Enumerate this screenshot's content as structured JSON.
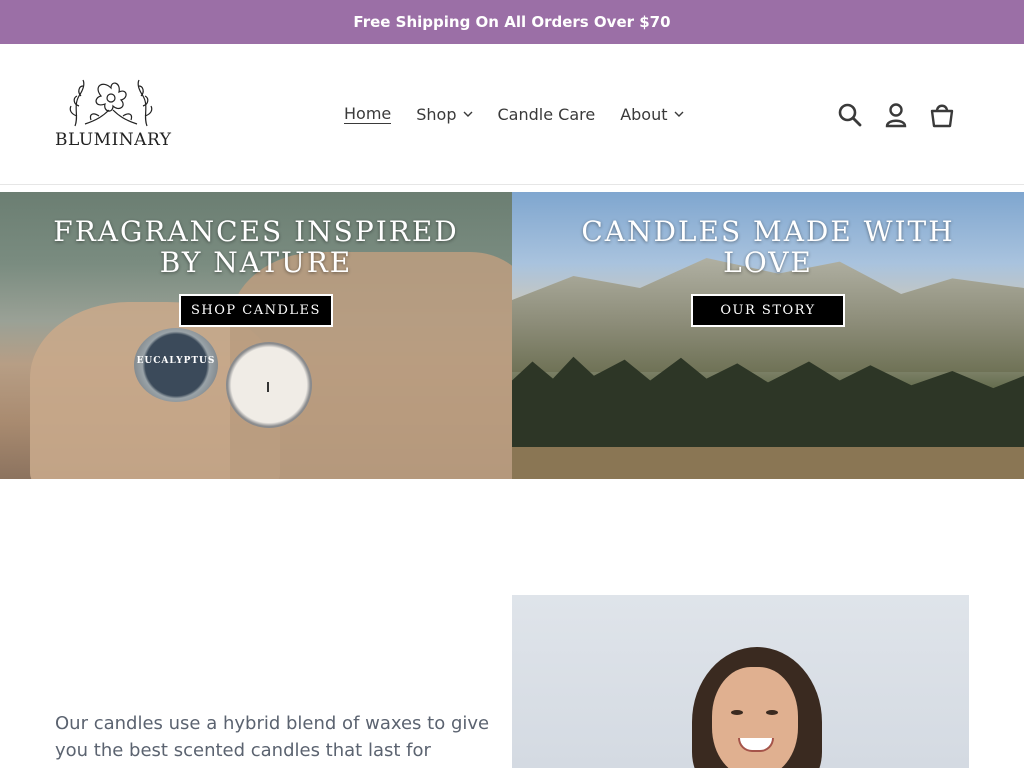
{
  "announcement": {
    "text": "Free Shipping On All Orders Over $70",
    "bg_color": "#9b6fa6"
  },
  "header": {
    "logo_text": "BLUMINARY",
    "nav": [
      {
        "label": "Home",
        "active": true,
        "has_dropdown": false
      },
      {
        "label": "Shop",
        "active": false,
        "has_dropdown": true
      },
      {
        "label": "Candle Care",
        "active": false,
        "has_dropdown": false
      },
      {
        "label": "About",
        "active": false,
        "has_dropdown": true
      }
    ],
    "icons": [
      "search-icon",
      "account-icon",
      "cart-icon"
    ]
  },
  "banners": [
    {
      "title_line1": "FRAGRANCES INSPIRED",
      "title_line2": "BY NATURE",
      "button_label": "SHOP CANDLES",
      "tin_label": "EUCALYPTUS"
    },
    {
      "title_line1": "CANDLES MADE WITH",
      "title_line2": "LOVE",
      "button_label": "OUR STORY"
    }
  ],
  "about": {
    "text": "Our candles use a hybrid blend of waxes to give you the best scented candles that last for"
  }
}
